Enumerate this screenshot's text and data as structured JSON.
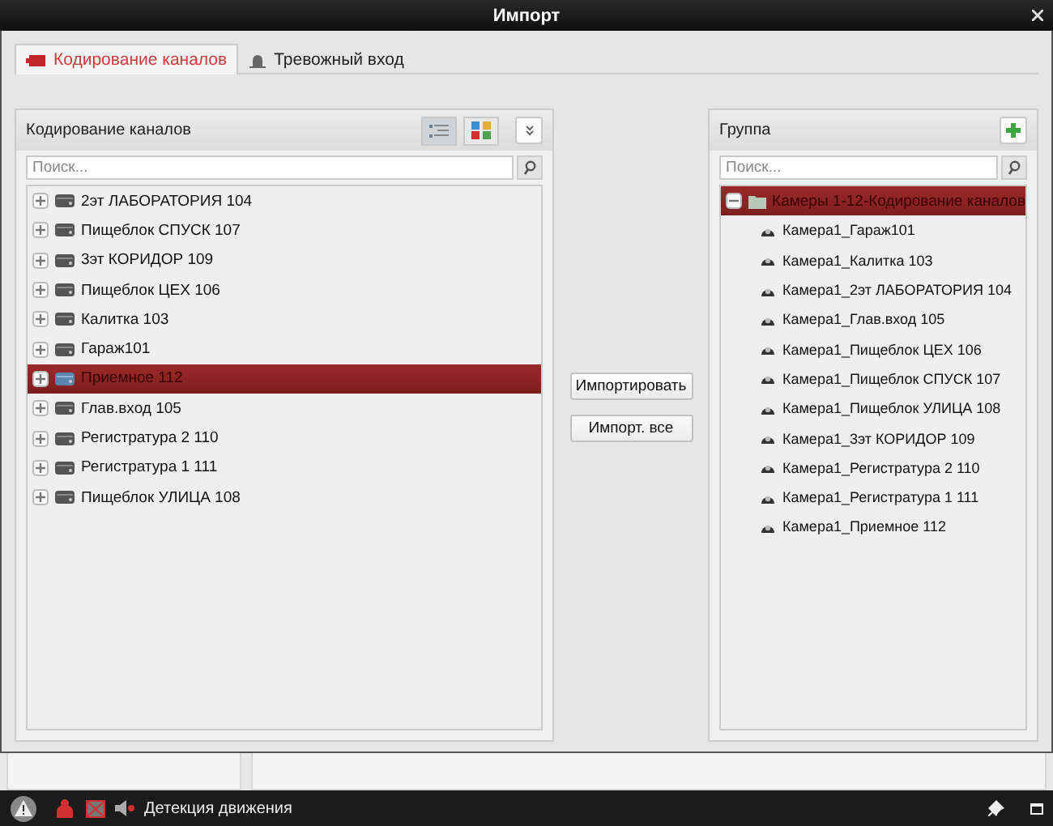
{
  "window": {
    "title": "Импорт"
  },
  "tabs": [
    {
      "label": "Кодирование каналов",
      "selected": true,
      "kind": "camera"
    },
    {
      "label": "Тревожный вход",
      "selected": false,
      "kind": "alarm"
    }
  ],
  "channels_panel": {
    "title": "Кодирование каналов",
    "view_modes": [
      {
        "kind": "list",
        "selected": true
      },
      {
        "kind": "grid",
        "selected": false
      }
    ],
    "search": {
      "placeholder": "Поиск..."
    },
    "devices": [
      {
        "name": "2эт ЛАБОРАТОРИЯ 104",
        "selected": false,
        "expanded": false
      },
      {
        "name": "Пищеблок СПУСК 107",
        "selected": false,
        "expanded": false
      },
      {
        "name": "3эт КОРИДОР 109",
        "selected": false,
        "expanded": false
      },
      {
        "name": "Пищеблок ЦЕХ 106",
        "selected": false,
        "expanded": false
      },
      {
        "name": "Калитка 103",
        "selected": false,
        "expanded": false
      },
      {
        "name": "Гараж101",
        "selected": false,
        "expanded": false
      },
      {
        "name": "Приемное 112",
        "selected": true,
        "expanded": false
      },
      {
        "name": "Глав.вход 105",
        "selected": false,
        "expanded": false
      },
      {
        "name": "Регистратура 2 110",
        "selected": false,
        "expanded": false
      },
      {
        "name": "Регистратура 1 111",
        "selected": false,
        "expanded": false
      },
      {
        "name": "Пищеблок УЛИЦА 108",
        "selected": false,
        "expanded": false
      }
    ]
  },
  "buttons": [
    "Импортировать",
    "Импорт. все"
  ],
  "group_panel": {
    "title": "Группа",
    "search": {
      "placeholder": "Поиск..."
    },
    "group": {
      "name": "Камеры 1-12-Кодирование каналов",
      "selected": true,
      "expanded": true,
      "children": [
        {
          "name": "Камера1_Гараж101"
        },
        {
          "name": "Камера1_Калитка 103"
        },
        {
          "name": "Камера1_2эт ЛАБОРАТОРИЯ 104"
        },
        {
          "name": "Камера1_Глав.вход 105"
        },
        {
          "name": "Камера1_Пищеблок ЦЕХ 106"
        },
        {
          "name": "Камера1_Пищеблок СПУСК 107"
        },
        {
          "name": "Камера1_Пищеблок УЛИЦА 108"
        },
        {
          "name": "Камера1_3эт КОРИДОР 109"
        },
        {
          "name": "Камера1_Регистратура 2 110"
        },
        {
          "name": "Камера1_Регистратура 1 111"
        },
        {
          "name": "Камера1_Приемное 112"
        }
      ]
    }
  },
  "status_bar": {
    "alarm": "Детекция движения"
  }
}
